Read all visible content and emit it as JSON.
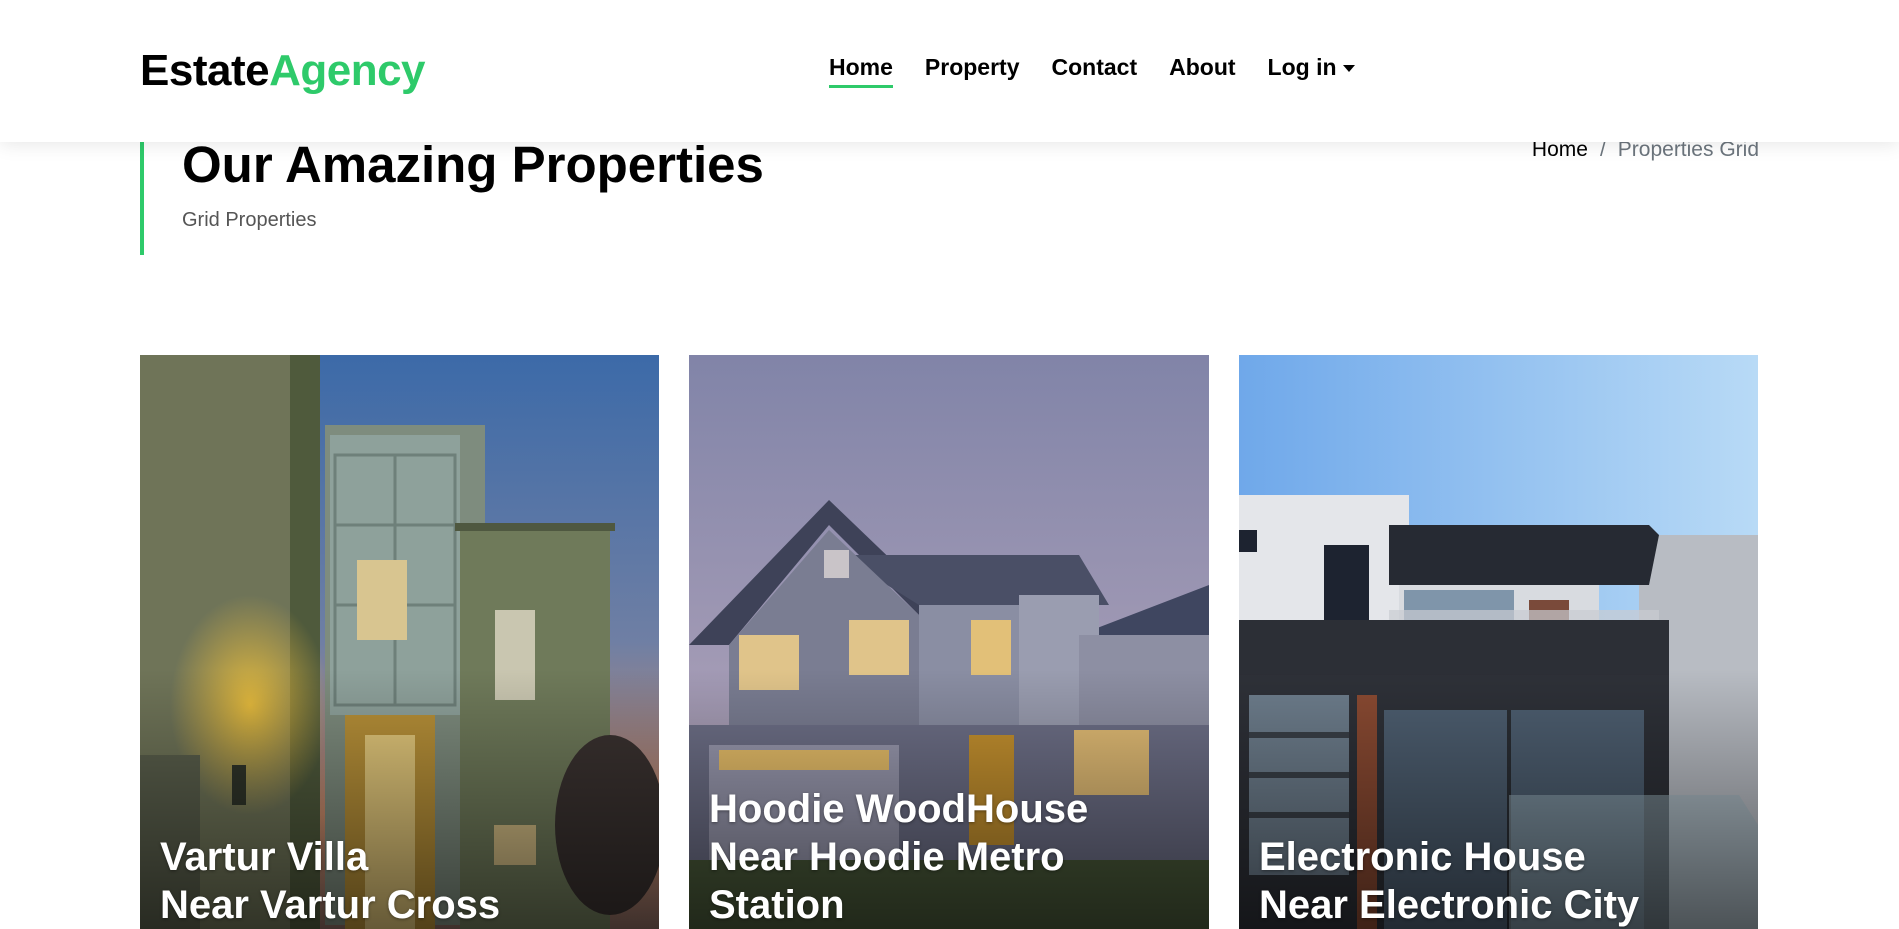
{
  "brand": {
    "part1": "Estate",
    "part2": "Agency"
  },
  "nav": {
    "items": [
      {
        "label": "Home",
        "active": true
      },
      {
        "label": "Property",
        "active": false
      },
      {
        "label": "Contact",
        "active": false
      },
      {
        "label": "About",
        "active": false
      },
      {
        "label": "Log in",
        "active": false,
        "dropdown": true
      }
    ]
  },
  "intro": {
    "title": "Our Amazing Properties",
    "subtitle": "Grid Properties"
  },
  "breadcrumb": {
    "home": "Home",
    "separator": "/",
    "current": "Properties Grid"
  },
  "properties": [
    {
      "line1": "Vartur Villa",
      "line2": "Near Vartur Cross",
      "line3": ""
    },
    {
      "line1": "Hoodie WoodHouse",
      "line2": "Near Hoodie Metro",
      "line3": "Station"
    },
    {
      "line1": "Electronic House",
      "line2": "Near Electronic City",
      "line3": ""
    }
  ],
  "colors": {
    "accent": "#2eca6a",
    "text": "#000000",
    "muted": "#6c757d"
  }
}
